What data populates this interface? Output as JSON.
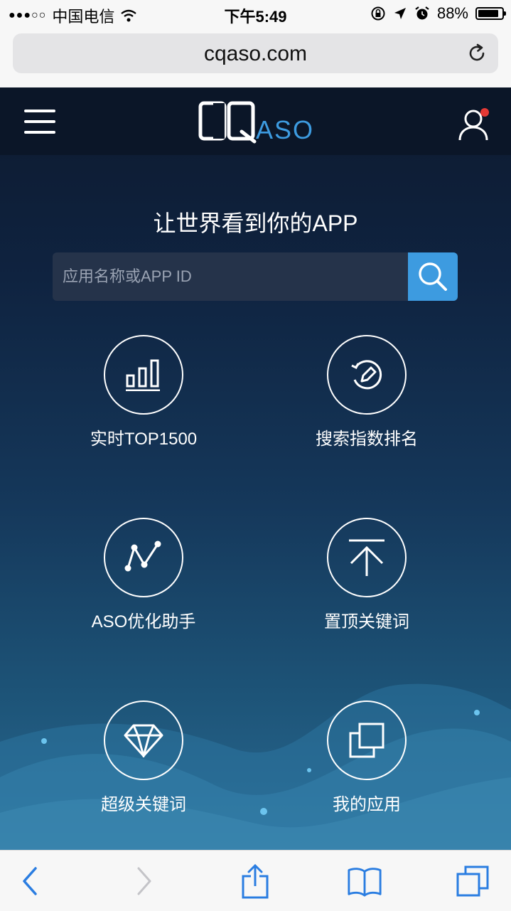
{
  "status_bar": {
    "signal": "●●●○○",
    "carrier": "中国电信",
    "time": "下午5:49",
    "battery_percent": "88%",
    "battery_level": 0.88
  },
  "browser": {
    "url": "cqaso.com"
  },
  "header": {
    "logo_text": "CQASO",
    "has_notification": true
  },
  "hero": {
    "tagline": "让世界看到你的APP",
    "search_placeholder": "应用名称或APP ID"
  },
  "tiles": [
    {
      "label": "实时TOP1500",
      "icon": "bar-chart-icon"
    },
    {
      "label": "搜索指数排名",
      "icon": "refresh-pen-icon"
    },
    {
      "label": "ASO优化助手",
      "icon": "trend-line-icon"
    },
    {
      "label": "置顶关键词",
      "icon": "pin-top-icon"
    },
    {
      "label": "超级关键词",
      "icon": "diamond-icon"
    },
    {
      "label": "我的应用",
      "icon": "copy-icon"
    }
  ],
  "colors": {
    "accent": "#3d9be0",
    "background": "#0f2340",
    "notification": "#e53935",
    "toolbar_icon": "#2a7de1"
  }
}
